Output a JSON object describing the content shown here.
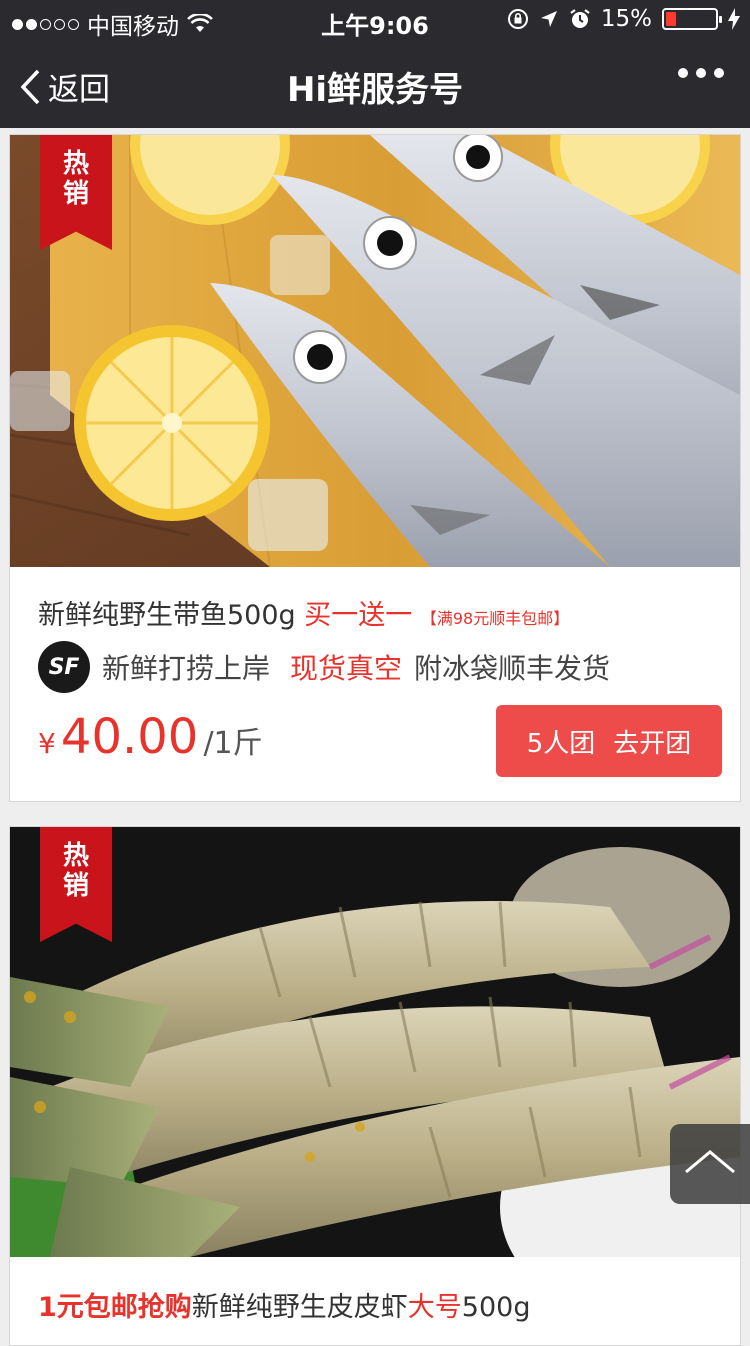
{
  "status_bar": {
    "carrier": "中国移动",
    "time": "上午9:06",
    "battery": "15%",
    "battery_level": 0.15
  },
  "nav": {
    "back_label": "返回",
    "title": "Hi鲜服务号"
  },
  "products": [
    {
      "tag": [
        "热",
        "销"
      ],
      "title_main": "新鲜纯野生带鱼500g",
      "title_promo": "买一送一",
      "title_note": "【满98元顺丰包邮】",
      "sub_text1": "新鲜打捞上岸",
      "sub_highlight": "现货真空",
      "sub_text2": "附冰袋顺丰发货",
      "sf_logo": "SF",
      "price_symbol": "¥",
      "price": "40.00",
      "price_unit": "/1斤",
      "group_count": "5人团",
      "group_action": "去开团"
    },
    {
      "tag": [
        "热",
        "销"
      ],
      "title_promo_prefix": "1元包邮抢购",
      "title_main": "新鲜纯野生皮皮虾",
      "title_size": "大号",
      "title_weight": "500g"
    }
  ],
  "colors": {
    "accent_red": "#e8332c",
    "button_red": "#ee4b4b",
    "tag_red": "#c8141a",
    "navbar_bg": "#2b2b2f"
  },
  "icons": [
    "wifi-icon",
    "rotation-lock-icon",
    "location-arrow-icon",
    "alarm-icon",
    "charging-bolt-icon",
    "back-chevron-icon",
    "more-icon",
    "scroll-top-icon"
  ]
}
